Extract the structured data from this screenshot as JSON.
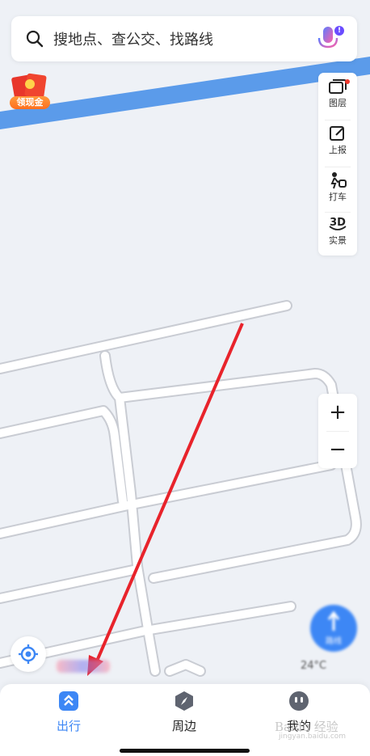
{
  "search": {
    "placeholder": "搜地点、查公交、找路线"
  },
  "mic": {
    "badge": "!"
  },
  "promo": {
    "label": "领现金"
  },
  "side_tools": [
    {
      "label": "图层",
      "icon": "layers-icon"
    },
    {
      "label": "上报",
      "icon": "report-edit-icon"
    },
    {
      "label": "打车",
      "icon": "taxi-icon"
    },
    {
      "label": "实景",
      "icon": "3d-view-icon"
    }
  ],
  "zoom": {
    "in": "+",
    "out": "−"
  },
  "route_fab": {
    "label": "路线"
  },
  "weather": {
    "temp": "24°C"
  },
  "bottom_nav": [
    {
      "label": "出行",
      "icon": "travel-icon",
      "active": true
    },
    {
      "label": "周边",
      "icon": "compass-icon",
      "active": false
    },
    {
      "label": "我的",
      "icon": "profile-icon",
      "active": false
    }
  ],
  "watermark": {
    "text": "Baidu 经验",
    "sub": "jingyan.baidu.com"
  },
  "colors": {
    "accent": "#3d87f5",
    "annotation_arrow": "#e8232b",
    "river": "#5b9bea"
  }
}
